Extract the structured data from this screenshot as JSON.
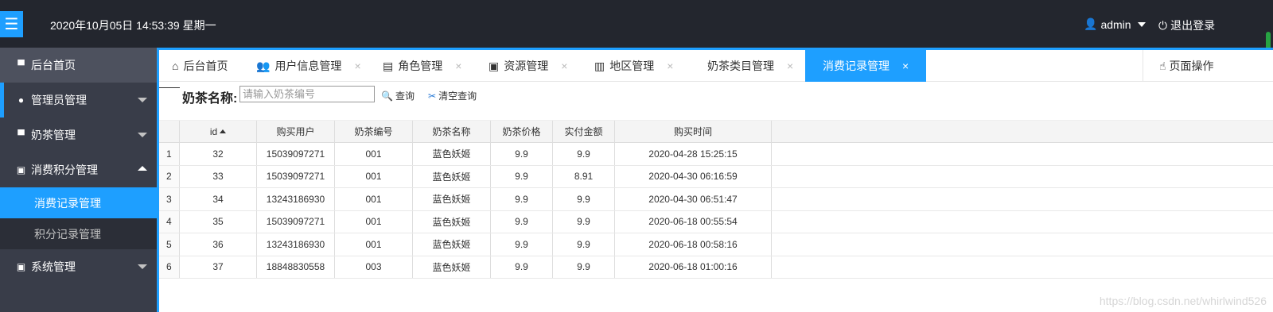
{
  "header": {
    "menu_icon": "hamburger-icon",
    "datetime": "2020年10月05日 14:53:39 星期一",
    "user": "admin",
    "logout": "退出登录"
  },
  "sidebar": {
    "items": [
      {
        "label": "后台首页",
        "icon": "monitor-icon"
      },
      {
        "label": "管理员管理",
        "icon": "user-icon"
      },
      {
        "label": "奶茶管理",
        "icon": "monitor-icon"
      },
      {
        "label": "消费积分管理",
        "icon": "screen-icon"
      },
      {
        "label": "系统管理",
        "icon": "screen-icon"
      }
    ],
    "subitems": [
      {
        "label": "消费记录管理"
      },
      {
        "label": "积分记录管理"
      }
    ]
  },
  "tabs": {
    "items": [
      {
        "label": "后台首页"
      },
      {
        "label": "用户信息管理"
      },
      {
        "label": "角色管理"
      },
      {
        "label": "资源管理"
      },
      {
        "label": "地区管理"
      },
      {
        "label": "奶茶类目管理"
      },
      {
        "label": "消费记录管理"
      }
    ],
    "close_symbol": "×",
    "page_op": "页面操作"
  },
  "search": {
    "label": "奶茶名称:",
    "placeholder": "请输入奶茶编号",
    "query_button": "查询",
    "clear_button": "清空查询"
  },
  "grid": {
    "columns": [
      "id",
      "购买用户",
      "奶茶编号",
      "奶茶名称",
      "奶茶价格",
      "实付金额",
      "购买时间"
    ],
    "rows": [
      {
        "n": "1",
        "id": "32",
        "user": "15039097271",
        "code": "001",
        "name": "蓝色妖姬",
        "price": "9.9",
        "paid": "9.9",
        "time": "2020-04-28 15:25:15"
      },
      {
        "n": "2",
        "id": "33",
        "user": "15039097271",
        "code": "001",
        "name": "蓝色妖姬",
        "price": "9.9",
        "paid": "8.91",
        "time": "2020-04-30 06:16:59"
      },
      {
        "n": "3",
        "id": "34",
        "user": "13243186930",
        "code": "001",
        "name": "蓝色妖姬",
        "price": "9.9",
        "paid": "9.9",
        "time": "2020-04-30 06:51:47"
      },
      {
        "n": "4",
        "id": "35",
        "user": "15039097271",
        "code": "001",
        "name": "蓝色妖姬",
        "price": "9.9",
        "paid": "9.9",
        "time": "2020-06-18 00:55:54"
      },
      {
        "n": "5",
        "id": "36",
        "user": "13243186930",
        "code": "001",
        "name": "蓝色妖姬",
        "price": "9.9",
        "paid": "9.9",
        "time": "2020-06-18 00:58:16"
      },
      {
        "n": "6",
        "id": "37",
        "user": "18848830558",
        "code": "003",
        "name": "蓝色妖姬",
        "price": "9.9",
        "paid": "9.9",
        "time": "2020-06-18 01:00:16"
      }
    ]
  },
  "watermark": "https://blog.csdn.net/whirlwind526",
  "colors": {
    "accent": "#1E9FFF",
    "header_bg": "#23262e",
    "sidebar_bg": "#393D49"
  }
}
